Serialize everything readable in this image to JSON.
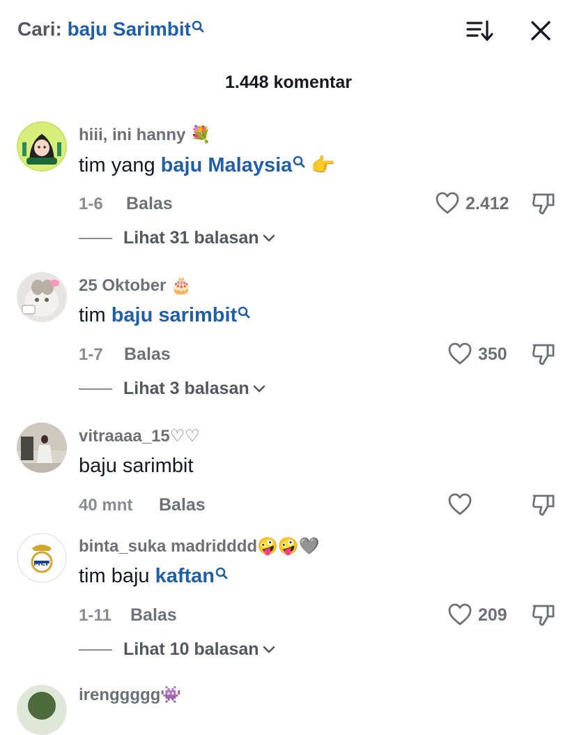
{
  "header": {
    "search_prefix": "Cari: ",
    "search_query": "baju Sarimbit",
    "comment_count": "1.448 komentar"
  },
  "comments": [
    {
      "username": "hiii, ini hanny",
      "username_emoji": "💐",
      "text_plain": "tim yang ",
      "text_link": "baju Malaysia",
      "text_after": "👉",
      "date": "1-6",
      "reply_label": "Balas",
      "likes": "2.412",
      "view_replies": "Lihat 31 balasan"
    },
    {
      "username": "25 Oktober",
      "username_emoji": "🎂",
      "text_plain": "tim ",
      "text_link": "baju sarimbit",
      "date": "1-7",
      "reply_label": "Balas",
      "likes": "350",
      "view_replies": "Lihat 3 balasan"
    },
    {
      "username": "vitraaaa_15",
      "username_emoji": "♡♡",
      "text_plain": "baju sarimbit",
      "date": "40 mnt",
      "reply_label": "Balas",
      "likes": ""
    },
    {
      "username": "binta_suka madridddd",
      "username_emoji": "🤪🤪🩶",
      "text_plain": "tim baju ",
      "text_link": "kaftan",
      "date": "1-11",
      "reply_label": "Balas",
      "likes": "209",
      "view_replies": "Lihat 10 balasan"
    },
    {
      "username": "irenggggg",
      "username_emoji": "👾"
    }
  ],
  "colors": {
    "link": "#1f5fa8",
    "text": "#161823",
    "muted": "#6f7077"
  },
  "icons": [
    "search-icon",
    "sort-icon",
    "close-icon",
    "heart-icon",
    "dislike-icon",
    "chevron-down-icon"
  ]
}
